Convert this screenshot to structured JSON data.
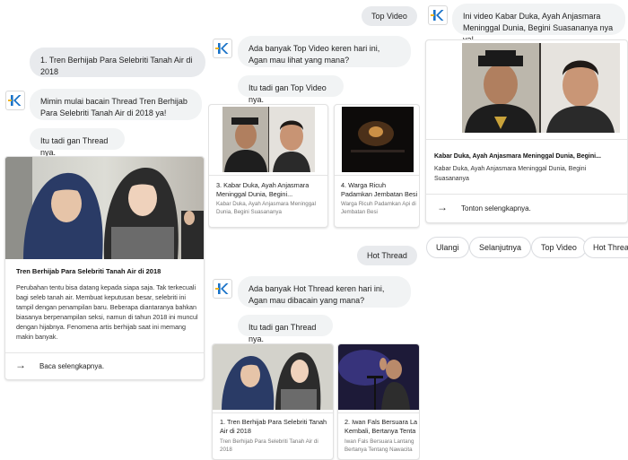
{
  "colors": {
    "accent_blue": "#1a73c8",
    "logo_yellow": "#f2b31b",
    "bubble_bg": "#f1f3f4"
  },
  "panel1": {
    "user_query": "1. Tren Berhijab Para Selebriti Tanah Air di 2018",
    "bot_message": "Mimin mulai bacain Thread Tren Berhijab Para Selebriti Tanah Air di 2018 ya!",
    "bot_followup": "Itu tadi gan Thread nya.",
    "card": {
      "title": "Tren Berhijab Para Selebriti Tanah Air di 2018",
      "body": "Perubahan tentu bisa datang kepada siapa saja. Tak terkecuali bagi seleb tanah air. Membuat keputusan besar, selebriti ini tampil dengan penampilan baru. Beberapa diantaranya bahkan biasanya berpenampilan seksi, namun di tahun 2018 ini muncul dengan hijabnya. Fenomena artis berhijab saat ini memang makin banyak.",
      "action": "Baca selengkapnya."
    }
  },
  "panel2": {
    "user_query_top": "Top Video",
    "bot_message_top": "Ada banyak Top Video keren hari ini, Agan mau lihat yang mana?",
    "bot_followup_top": "Itu tadi gan Top Video nya.",
    "top_cards": [
      {
        "title": "3. Kabar Duka, Ayah Anjasmara Meninggal Dunia, Begini...",
        "desc": "Kabar Duka, Ayah Anjasmara Meninggal Dunia, Begini Suasananya"
      },
      {
        "title": "4. Warga Ricuh Padamkan Jembatan Besi",
        "desc": "Warga Ricuh Padamkan Api di Jembatan Besi"
      }
    ],
    "user_query_hot": "Hot Thread",
    "bot_message_hot": "Ada banyak Hot Thread keren hari ini, Agan mau dibacain yang mana?",
    "bot_followup_hot": "Itu tadi gan Thread nya.",
    "hot_cards": [
      {
        "title": "1. Tren Berhijab Para Selebriti Tanah Air di 2018",
        "desc": "Tren Berhijab Para Selebriti Tanah Air di 2018"
      },
      {
        "title": "2. Iwan Fals Bersuara La Kembali, Bertanya Tenta",
        "desc": "Iwan Fals Bersuara Lantang Bertanya Tentang Nawacita"
      }
    ]
  },
  "panel3": {
    "bot_message": "Ini video Kabar Duka, Ayah Anjasmara Meninggal Dunia, Begini Suasananya nya ya!",
    "card": {
      "title": "Kabar Duka, Ayah Anjasmara Meninggal Dunia, Begini...",
      "body": "Kabar Duka, Ayah Anjasmara Meninggal Dunia, Begini Suasananya",
      "action": "Tonton selengkapnya."
    },
    "chips": [
      "Ulangi",
      "Selanjutnya",
      "Top Video",
      "Hot Threa"
    ]
  }
}
